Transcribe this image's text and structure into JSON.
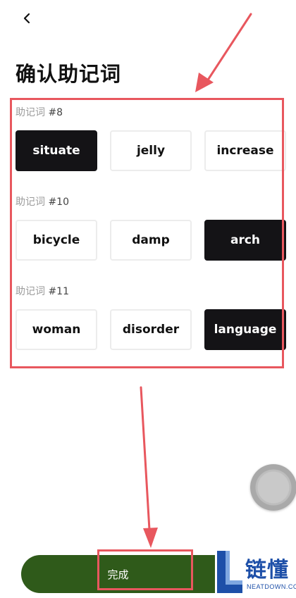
{
  "header": {
    "back_icon": "chevron-left-icon",
    "title": "确认助记词"
  },
  "groups": [
    {
      "label_prefix": "助记词 ",
      "label_num": "#8",
      "options": [
        {
          "word": "situate",
          "selected": true
        },
        {
          "word": "jelly",
          "selected": false
        },
        {
          "word": "increase",
          "selected": false
        }
      ]
    },
    {
      "label_prefix": "助记词 ",
      "label_num": "#10",
      "options": [
        {
          "word": "bicycle",
          "selected": false
        },
        {
          "word": "damp",
          "selected": false
        },
        {
          "word": "arch",
          "selected": true
        }
      ]
    },
    {
      "label_prefix": "助记词 ",
      "label_num": "#11",
      "options": [
        {
          "word": "woman",
          "selected": false
        },
        {
          "word": "disorder",
          "selected": false
        },
        {
          "word": "language",
          "selected": true
        }
      ]
    }
  ],
  "footer": {
    "done_label": "完成",
    "button_color": "#2f5a1a"
  },
  "annotation_color": "#e8575e",
  "watermark": {
    "text": "链懂",
    "sub": "NEATDOWN.COM"
  }
}
